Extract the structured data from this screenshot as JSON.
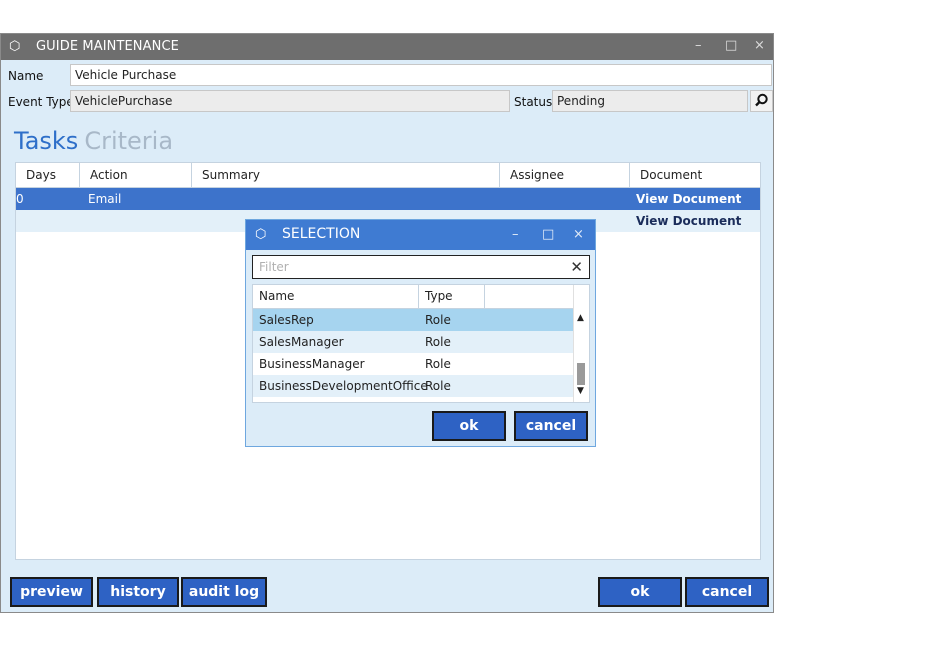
{
  "window": {
    "title": "GUIDE MAINTENANCE",
    "controls": {
      "minimize": "–",
      "maximize": "□",
      "close": "×"
    }
  },
  "form": {
    "name_label": "Name",
    "name_value": "Vehicle Purchase",
    "event_type_label": "Event Type",
    "event_type_value": "VehiclePurchase",
    "status_label": "Status",
    "status_value": "Pending"
  },
  "tabs": [
    {
      "label": "Tasks",
      "active": true
    },
    {
      "label": "Criteria",
      "active": false
    }
  ],
  "tasks_grid": {
    "columns": [
      "Days",
      "Action",
      "Summary",
      "Assignee",
      "Document"
    ],
    "rows": [
      {
        "days": "0",
        "action": "Email",
        "summary": "",
        "assignee": "",
        "document": "View Document",
        "selected": true
      },
      {
        "days": "",
        "action": "",
        "summary": "",
        "assignee": "",
        "document": "View Document",
        "selected": false
      }
    ]
  },
  "bottom_buttons": {
    "preview": "preview",
    "history": "history",
    "audit_log": "audit log",
    "ok": "ok",
    "cancel": "cancel"
  },
  "selection_dialog": {
    "title": "SELECTION",
    "controls": {
      "minimize": "–",
      "maximize": "□",
      "close": "×"
    },
    "filter_placeholder": "Filter",
    "columns": [
      "Name",
      "Type"
    ],
    "rows": [
      {
        "name": "SalesRep",
        "type": "Role",
        "selected": true
      },
      {
        "name": "SalesManager",
        "type": "Role"
      },
      {
        "name": "BusinessManager",
        "type": "Role"
      },
      {
        "name": "BusinessDevelopmentOffice",
        "type": "Role"
      }
    ],
    "ok": "ok",
    "cancel": "cancel"
  },
  "colors": {
    "accent": "#3d73cb",
    "button": "#2e62c4",
    "window_bg": "#dcecf8",
    "titlebar": "#6e6e6e",
    "dialog_titlebar": "#3f7bd2",
    "selected_row_dialog": "#a6d4ef",
    "alt_row": "#e3f0f9"
  },
  "icons": {
    "window_icon": "cube-icon",
    "search": "magnifier-icon",
    "clear": "close-icon"
  }
}
